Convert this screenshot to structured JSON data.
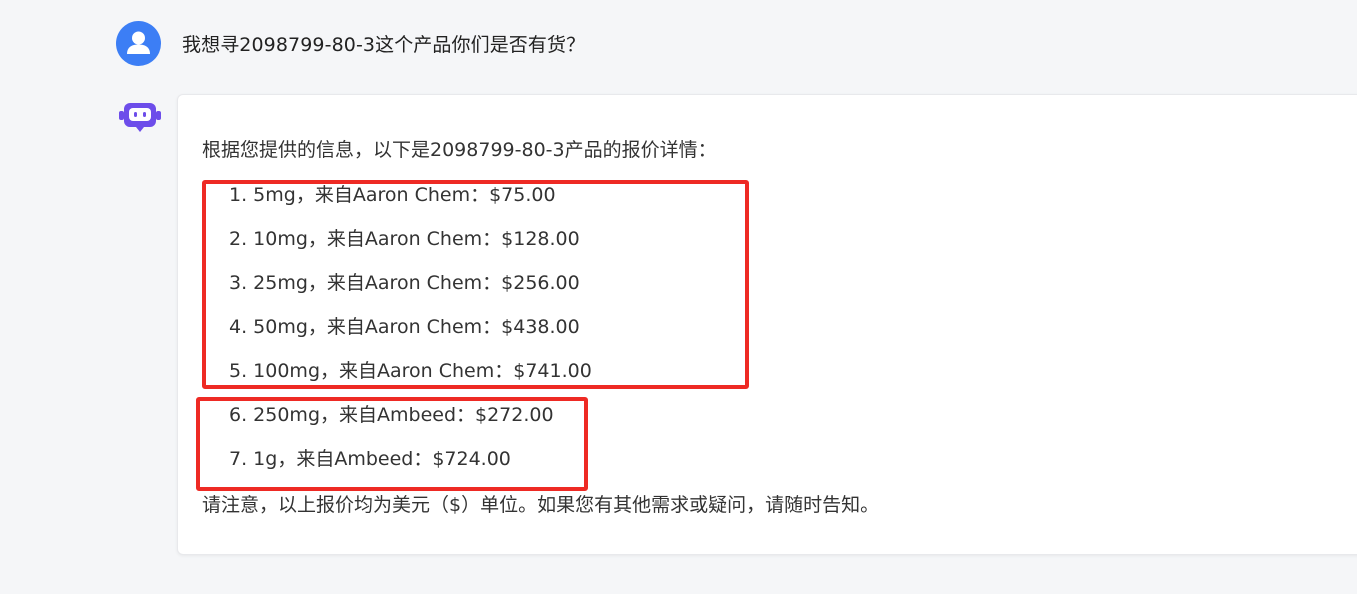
{
  "user_message": {
    "text": "我想寻2098799-80-3这个产品你们是否有货？"
  },
  "bot_message": {
    "intro": "根据您提供的信息，以下是2098799-80-3产品的报价详情：",
    "items": [
      "1. 5mg，来自Aaron Chem：$75.00",
      "2. 10mg，来自Aaron Chem：$128.00",
      "3. 25mg，来自Aaron Chem：$256.00",
      "4. 50mg，来自Aaron Chem：$438.00",
      "5. 100mg，来自Aaron Chem：$741.00",
      "6. 250mg，来自Ambeed：$272.00",
      "7. 1g，来自Ambeed：$724.00"
    ],
    "note": "请注意，以上报价均为美元（$）单位。如果您有其他需求或疑问，请随时告知。"
  },
  "icons": {
    "user_avatar": "user-avatar-icon",
    "bot_avatar": "robot-icon"
  },
  "colors": {
    "background": "#f5f6f8",
    "avatar_blue": "#3c7ef5",
    "bot_purple": "#6d4dea",
    "highlight_red": "#ee2a24",
    "text": "#333333"
  }
}
